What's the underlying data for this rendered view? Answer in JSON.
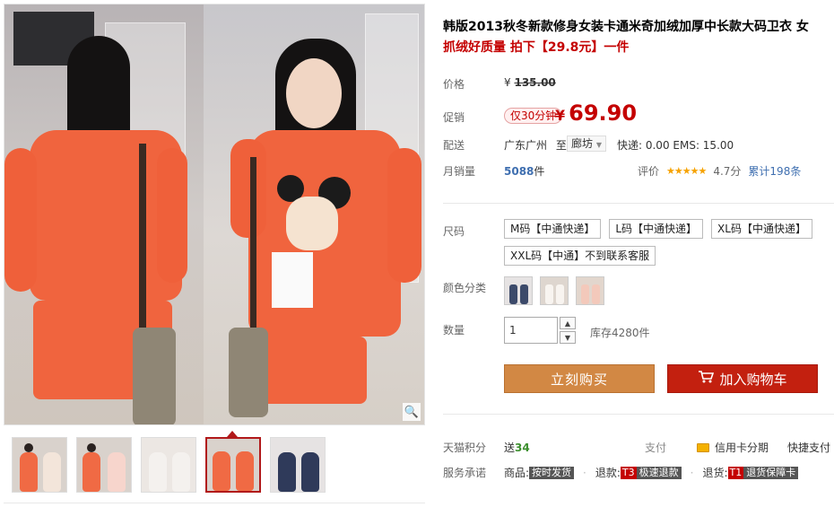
{
  "gallery": {
    "zoom_icon": "magnifier-icon",
    "thumbnail_count": 5,
    "active_thumbnail": 4
  },
  "product": {
    "title": "韩版2013秋冬新款修身女装卡通米奇加绒加厚中长款大码卫衣 女",
    "subtitle": "抓绒好质量 拍下【29.8元】一件"
  },
  "price": {
    "label": "价格",
    "currency": "¥",
    "original": "135.00"
  },
  "promotion": {
    "label": "促销",
    "tag": "仅30分钟",
    "currency": "¥",
    "price": "69.90"
  },
  "shipping": {
    "label": "配送",
    "from": "广东广州",
    "to_prefix": "至",
    "to": "廊坊",
    "fee": "快递: 0.00 EMS: 15.00"
  },
  "sales": {
    "label": "月销量",
    "count": "5088",
    "unit": "件",
    "rating_label": "评价",
    "stars": "★★★★★",
    "score": "4.7分",
    "total": "累计198条"
  },
  "options": {
    "size_label": "尺码",
    "sizes": [
      "M码【中通快递】",
      "L码【中通快递】",
      "XL码【中通快递】",
      "XXL码【中通】不到联系客服"
    ],
    "color_label": "颜色分类",
    "colors": [
      "#3c4a6a",
      "#e8d9cf",
      "#efc9b5"
    ]
  },
  "quantity": {
    "label": "数量",
    "value": "1",
    "stock": "库存4280件"
  },
  "actions": {
    "buy_now": "立刻购买",
    "add_to_cart": "加入购物车"
  },
  "tmall": {
    "points_label": "天猫积分",
    "points_prefix": "送",
    "points_value": "34",
    "pay_label": "支付",
    "credit": "信用卡分期",
    "express_pay": "快捷支付"
  },
  "service": {
    "label": "服务承诺",
    "goods_label": "商品:",
    "goods_tag": "按时发货",
    "refund_label": "退款:",
    "refund_code": "T3",
    "refund_tag": "极速退款",
    "return_label": "退货:",
    "return_code": "T1",
    "return_tag": "退货保障卡"
  },
  "colors_theme": {
    "accent_red": "#c40000",
    "buy_orange": "#d28844",
    "cart_red": "#c3200f",
    "link_blue": "#3f6fb0"
  }
}
